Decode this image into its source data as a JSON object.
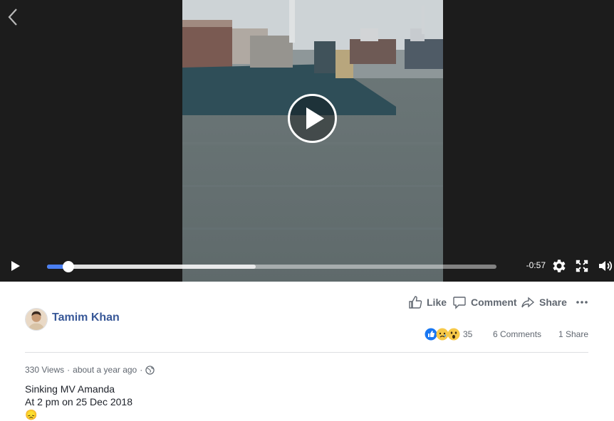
{
  "player": {
    "time_remaining": "-0:57",
    "progress_fraction": 0.048,
    "buffered_fraction": 0.465,
    "icons": {
      "back": "chevron-left-icon",
      "big_play": "play-circle-icon",
      "play": "play-icon",
      "settings": "gear-icon",
      "fullscreen": "fullscreen-icon",
      "volume": "volume-icon"
    }
  },
  "actions": {
    "like": "Like",
    "comment": "Comment",
    "share": "Share",
    "more_icon": "more-dots-icon"
  },
  "post": {
    "author": "Tamim Khan",
    "reactions_count": "35",
    "reaction_types": [
      "like",
      "sad",
      "wow"
    ],
    "comments": "6 Comments",
    "shares": "1 Share",
    "views": "330 Views",
    "timestamp": "about a year ago",
    "privacy_icon": "globe-icon",
    "description": [
      "Sinking MV Amanda",
      "At 2 pm on 25 Dec 2018"
    ],
    "emoji": "😞"
  },
  "colors": {
    "accent": "#4a7ff2",
    "author": "#385898",
    "secondary_text": "#606770"
  }
}
